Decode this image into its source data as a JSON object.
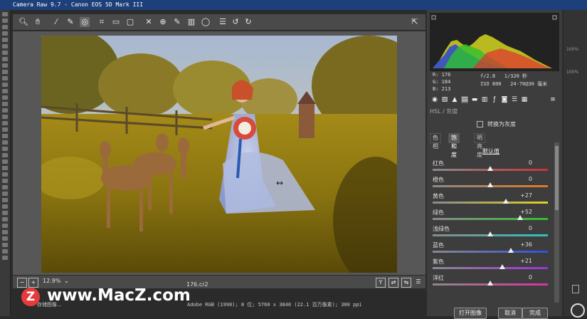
{
  "window": {
    "title": "Camera Raw 9.7 -  Canon EOS 5D Mark III"
  },
  "colors": {
    "titlebar": "#1d3f7a",
    "panel": "#3d3d3d",
    "canvas": "#575757",
    "watermark_logo": "#e43b3b"
  },
  "toolbar": {
    "icons": [
      "zoom-icon",
      "hand-icon",
      "white-balance-icon",
      "color-sampler-icon",
      "target-adjust-icon",
      "crop-icon",
      "straighten-icon",
      "transform-icon",
      "spot-removal-icon",
      "red-eye-icon",
      "adjust-brush-icon",
      "graduated-filter-icon",
      "radial-filter-icon",
      "preferences-icon",
      "rotate-left-icon",
      "rotate-right-icon",
      "open-fullscreen-icon"
    ]
  },
  "info": {
    "r_label": "R:",
    "r_value": "176",
    "g_label": "G:",
    "g_value": "184",
    "b_label": "B:",
    "b_value": "213",
    "aperture": "f/2.8",
    "shutter": "1/320 秒",
    "iso": "ISO 800",
    "lens": "24-70@30 毫米"
  },
  "panel": {
    "section_title": "HSL / 灰度",
    "convert_grayscale": "转换为灰度",
    "tabs": [
      "色相",
      "饱和度",
      "明亮度"
    ],
    "active_tab": 1,
    "defaults_link": "默认值",
    "sliders": [
      {
        "label": "红色",
        "value": "0",
        "pos": 0.5,
        "track": "linear-gradient(to right,#8a8a8a,#d23030)"
      },
      {
        "label": "橙色",
        "value": "0",
        "pos": 0.5,
        "track": "linear-gradient(to right,#8a8a8a,#e07a20)"
      },
      {
        "label": "黄色",
        "value": "+27",
        "pos": 0.635,
        "track": "linear-gradient(to right,#8a8a8a,#e0d020)"
      },
      {
        "label": "绿色",
        "value": "+52",
        "pos": 0.76,
        "track": "linear-gradient(to right,#8a8a8a,#30c030)"
      },
      {
        "label": "浅绿色",
        "value": "0",
        "pos": 0.5,
        "track": "linear-gradient(to right,#8a8a8a,#30c0c0)"
      },
      {
        "label": "蓝色",
        "value": "+36",
        "pos": 0.68,
        "track": "linear-gradient(to right,#8a8a8a,#3050e0)"
      },
      {
        "label": "紫色",
        "value": "+21",
        "pos": 0.605,
        "track": "linear-gradient(to right,#8a8a8a,#a030e0)"
      },
      {
        "label": "洋红",
        "value": "0",
        "pos": 0.5,
        "track": "linear-gradient(to right,#8a8a8a,#e030a0)"
      }
    ]
  },
  "bottom": {
    "zoom": "12.9%",
    "filename": "176.cr2",
    "file_info": "Adobe RGB (1998); 8 位; 5760 x 3840 (22.1 百万像素); 300 ppi",
    "open_image": "打开图像",
    "cancel": "取消",
    "done": "完成",
    "left_button": "存储图像..."
  },
  "watermark": {
    "logo_letter": "Z",
    "text": "www.MacZ.com"
  },
  "right_strip": {
    "pct1": "100%",
    "pct2": "100%"
  }
}
